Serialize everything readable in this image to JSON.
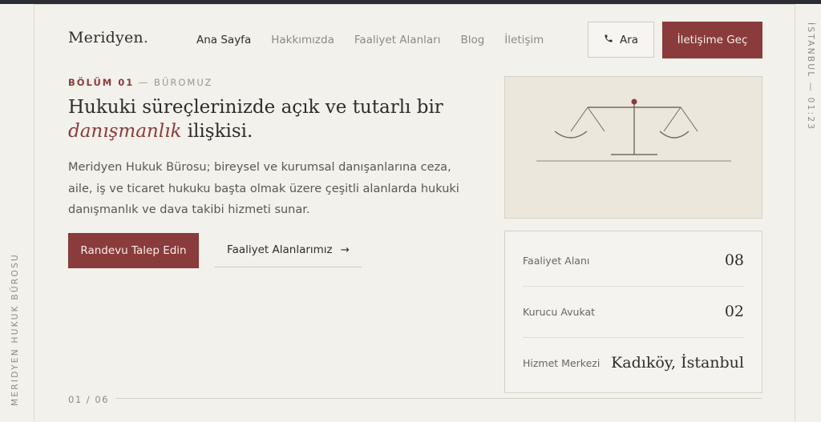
{
  "brand": {
    "name": "Meridyen",
    "dot": "."
  },
  "nav": {
    "items": [
      {
        "label": "Ana Sayfa",
        "active": true
      },
      {
        "label": "Hakkımızda"
      },
      {
        "label": "Faaliyet Alanları"
      },
      {
        "label": "Blog"
      },
      {
        "label": "İletişim"
      }
    ]
  },
  "header": {
    "call_label": "Ara",
    "cta_label": "İletişime Geç"
  },
  "rails": {
    "left": "MERIDYEN HUKUK BÜROSU",
    "right": "İSTANBUL — 01:23"
  },
  "hero": {
    "section_num": "BÖLÜM 01",
    "section_name": "— BÜROMUZ",
    "title_part1": "Hukuki süreçlerinizde açık ve tutarlı bir",
    "title_emphasis": "danışmanlık",
    "title_part2": "ilişkisi.",
    "description": "Meridyen Hukuk Bürosu; bireysel ve kurumsal danışanlarına ceza, aile, iş ve ticaret hukuku başta olmak üzere çeşitli alanlarda hukuki danışmanlık ve dava takibi hizmeti sunar.",
    "primary_button": "Randevu Talep Edin",
    "secondary_button": "Faaliyet Alanlarımız",
    "secondary_arrow": "→"
  },
  "stats": [
    {
      "label": "Faaliyet Alanı",
      "value": "08"
    },
    {
      "label": "Kurucu Avukat",
      "value": "02"
    },
    {
      "label": "Hizmet Merkezi",
      "value": "Kadıköy, İstanbul"
    }
  ],
  "pager": {
    "text": "01 / 06"
  },
  "colors": {
    "accent": "#8a3b3b",
    "background": "#f3f1ec",
    "text": "#2f2c29",
    "muted": "#8e8a83"
  },
  "icons": {
    "call": "phone-icon",
    "arrow": "arrow-right-icon",
    "illustration": "scales-of-justice-icon"
  }
}
